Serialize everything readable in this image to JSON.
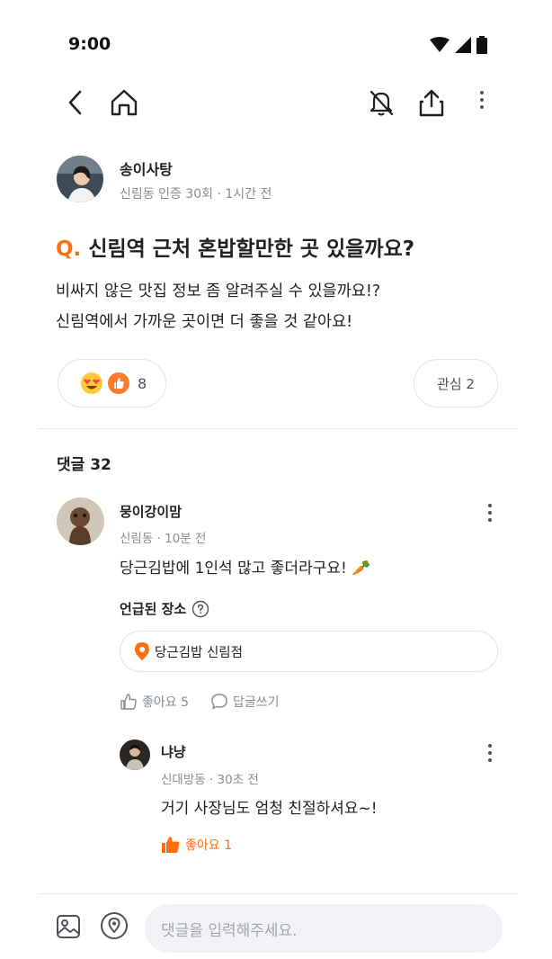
{
  "status_bar": {
    "time": "9:00"
  },
  "post": {
    "author": {
      "name": "송이사탕",
      "meta": "신림동 인증 30회 · 1시간 전"
    },
    "question_mark": "Q.",
    "title": "신림역 근처 혼밥할만한 곳 있을까요?",
    "body_lines": [
      "비싸지 않은 맛집 정보 좀 알려주실 수 있을까요!?",
      "신림역에서 가까운 곳이면 더 좋을 것 같아요!"
    ],
    "reactions": {
      "count": "8"
    },
    "interest": {
      "label": "관심 2"
    }
  },
  "comments_section": {
    "header": "댓글 32"
  },
  "comment1": {
    "name": "뭉이강이맘",
    "meta": "신림동 · 10분 전",
    "text": "당근김밥에 1인석 많고 좋더라구요! 🥕",
    "mentioned_label": "언급된 장소",
    "place": "당근김밥 신림점",
    "like_label": "좋아요 5",
    "reply_label": "답글쓰기"
  },
  "reply1": {
    "name": "냐냥",
    "meta": "신대방동 · 30초 전",
    "text": "거기 사장님도 엄청 친절하셔요~!",
    "like_label": "좋아요 1"
  },
  "input_bar": {
    "placeholder": "댓글을 입력해주세요."
  },
  "colors": {
    "accent": "#ff6f0f",
    "text": "#212124",
    "muted": "#868b94",
    "border": "#e3e5e8"
  }
}
